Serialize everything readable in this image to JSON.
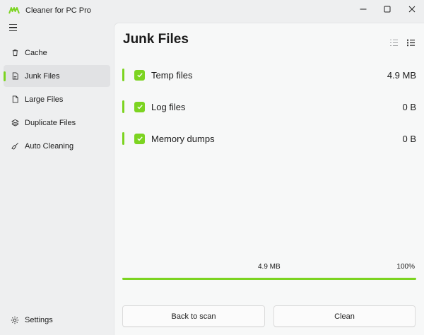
{
  "app": {
    "title": "Cleaner for PC Pro"
  },
  "colors": {
    "accent": "#7cd421",
    "sidebar_bg": "#eeeff0",
    "panel_bg": "#f7f8f8"
  },
  "window_controls": {
    "minimize_icon": "minimize-icon",
    "maximize_icon": "maximize-icon",
    "close_icon": "close-icon"
  },
  "sidebar": {
    "menu_icon": "hamburger-icon",
    "items": [
      {
        "label": "Cache",
        "icon": "trash-icon",
        "active": false
      },
      {
        "label": "Junk Files",
        "icon": "document-icon",
        "active": true
      },
      {
        "label": "Large Files",
        "icon": "file-icon",
        "active": false
      },
      {
        "label": "Duplicate Files",
        "icon": "layers-icon",
        "active": false
      },
      {
        "label": "Auto Cleaning",
        "icon": "broom-icon",
        "active": false
      }
    ],
    "settings_label": "Settings"
  },
  "main": {
    "title": "Junk Files",
    "items": [
      {
        "label": "Temp files",
        "size": "4.9 MB",
        "checked": true
      },
      {
        "label": "Log files",
        "size": "0 B",
        "checked": true
      },
      {
        "label": "Memory dumps",
        "size": "0 B",
        "checked": true
      }
    ],
    "progress": {
      "total": "4.9 MB",
      "percent_label": "100%",
      "value": 1.0
    },
    "buttons": {
      "back": "Back to scan",
      "clean": "Clean"
    }
  }
}
